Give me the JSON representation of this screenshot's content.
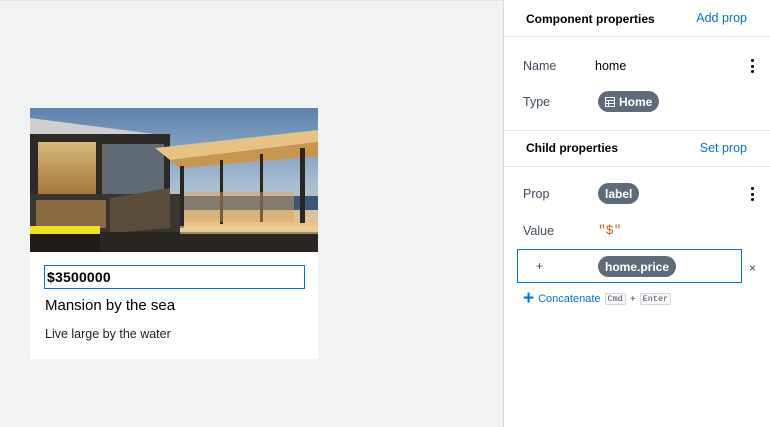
{
  "card": {
    "price": "$3500000",
    "title": "Mansion by the sea",
    "description": "Live large by the water"
  },
  "component_properties": {
    "title": "Component properties",
    "add_prop_label": "Add prop",
    "name_label": "Name",
    "name_value": "home",
    "type_label": "Type",
    "type_value": "Home"
  },
  "child_properties": {
    "title": "Child properties",
    "set_prop_label": "Set prop",
    "prop_label": "Prop",
    "prop_value": "label",
    "value_label": "Value",
    "value_literal": "\"$\"",
    "concat_operator": "+",
    "concat_value": "home.price",
    "close_symbol": "×",
    "concatenate_label": "Concatenate",
    "shortcut_key1": "Cmd",
    "shortcut_sep": "+",
    "shortcut_key2": "Enter"
  },
  "colors": {
    "accent": "#0972d3",
    "pill": "#5f6b7a",
    "literal": "#d45b07"
  }
}
